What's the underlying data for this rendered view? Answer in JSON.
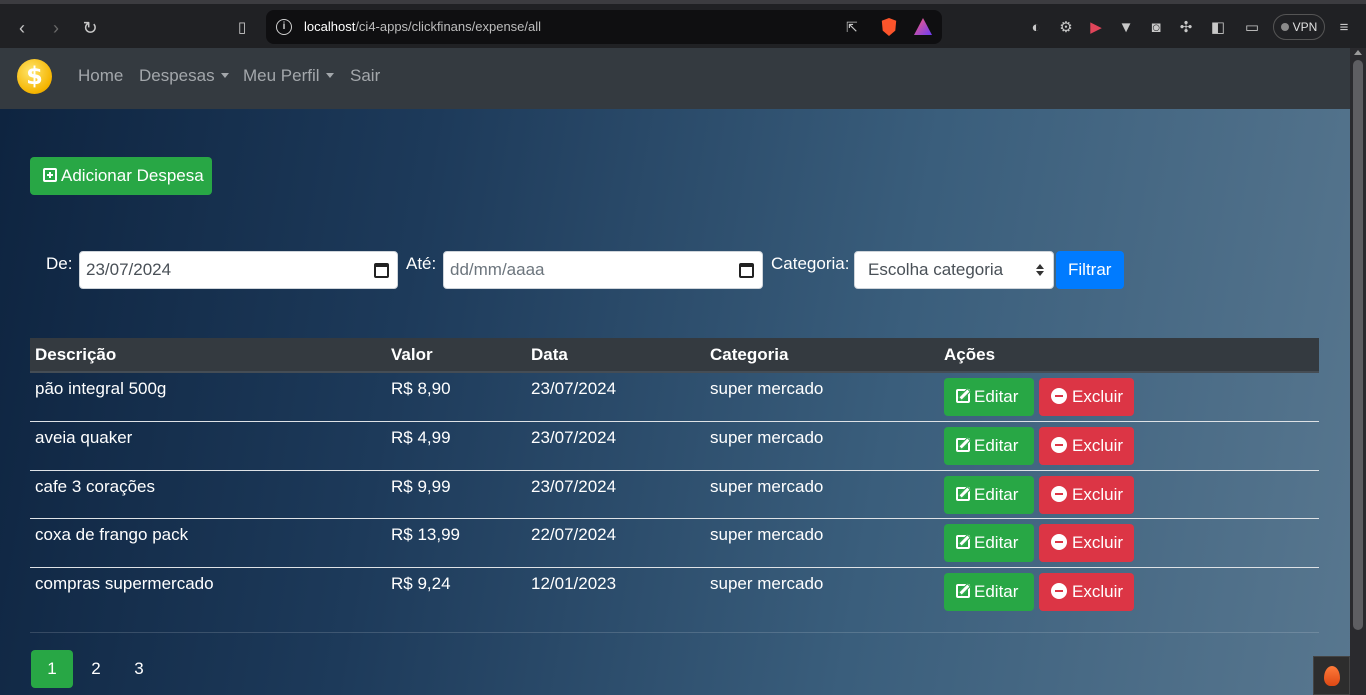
{
  "browser": {
    "url_host": "localhost",
    "url_path": "/ci4-apps/clickfinans/expense/all",
    "vpn_label": "VPN"
  },
  "navbar": {
    "logo_symbol": "$",
    "home": "Home",
    "despesas": "Despesas",
    "perfil": "Meu Perfil",
    "sair": "Sair"
  },
  "actions": {
    "add_label": "Adicionar Despesa"
  },
  "filters": {
    "from_label": "De:",
    "from_value": "23/07/2024",
    "to_label": "Até:",
    "to_placeholder": "dd/mm/aaaa",
    "category_label": "Categoria:",
    "category_selected": "Escolha categoria",
    "filter_button": "Filtrar"
  },
  "table": {
    "headers": [
      "Descrição",
      "Valor",
      "Data",
      "Categoria",
      "Ações"
    ],
    "edit_label": "Editar",
    "delete_label": "Excluir",
    "rows": [
      {
        "descricao": "pão integral 500g",
        "valor": "R$ 8,90",
        "data": "23/07/2024",
        "categoria": "super mercado"
      },
      {
        "descricao": "aveia quaker",
        "valor": "R$ 4,99",
        "data": "23/07/2024",
        "categoria": "super mercado"
      },
      {
        "descricao": "cafe 3 corações",
        "valor": "R$ 9,99",
        "data": "23/07/2024",
        "categoria": "super mercado"
      },
      {
        "descricao": "coxa de frango pack",
        "valor": "R$ 13,99",
        "data": "22/07/2024",
        "categoria": "super mercado"
      },
      {
        "descricao": "compras supermercado",
        "valor": "R$ 9,24",
        "data": "12/01/2023",
        "categoria": "super mercado"
      }
    ]
  },
  "pagination": {
    "pages": [
      "1",
      "2",
      "3"
    ],
    "active": "1"
  },
  "colors": {
    "success": "#28a745",
    "danger": "#dc3545",
    "primary": "#007bff",
    "navbar": "#343a40"
  }
}
